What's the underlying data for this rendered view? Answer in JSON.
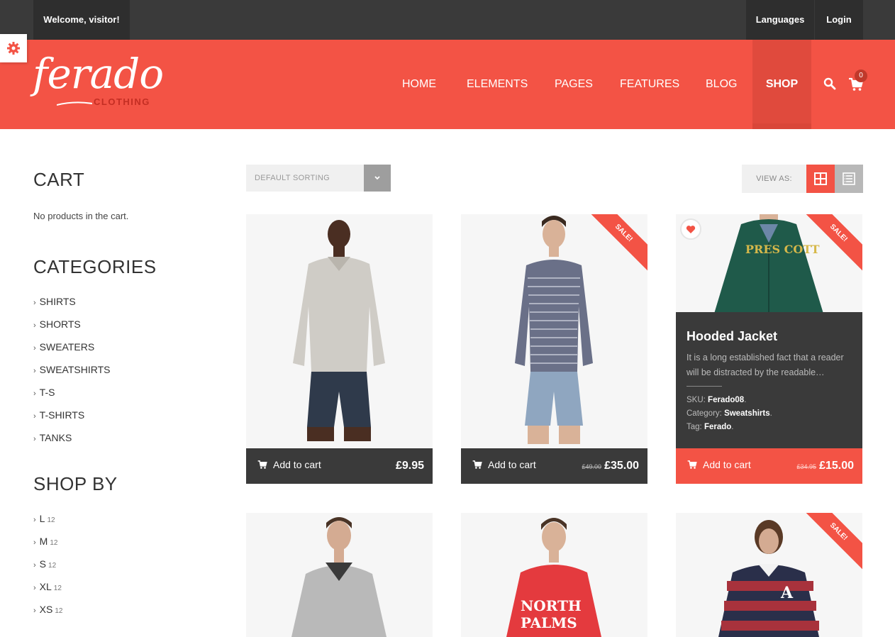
{
  "topbar": {
    "welcome": "Welcome, visitor!",
    "languages": "Languages",
    "login": "Login"
  },
  "header": {
    "logo_script": "ferado",
    "logo_sub": "CLOTHING",
    "nav": [
      "HOME",
      "ELEMENTS",
      "PAGES",
      "FEATURES",
      "BLOG",
      "SHOP"
    ],
    "active_nav": "SHOP",
    "cart_count": "0"
  },
  "sidebar": {
    "cart_title": "CART",
    "cart_empty": "No products in the cart.",
    "categories_title": "CATEGORIES",
    "categories": [
      "SHIRTS",
      "SHORTS",
      "SWEATERS",
      "SWEATSHIRTS",
      "T-S",
      "T-SHIRTS",
      "TANKS"
    ],
    "shopby_title": "SHOP BY",
    "sizes": [
      {
        "label": "L",
        "count": "12"
      },
      {
        "label": "M",
        "count": "12"
      },
      {
        "label": "S",
        "count": "12"
      },
      {
        "label": "XL",
        "count": "12"
      },
      {
        "label": "XS",
        "count": "12"
      }
    ]
  },
  "toolbar": {
    "sorting": "DEFAULT SORTING",
    "view_as": "VIEW AS:"
  },
  "products": [
    {
      "add_label": "Add to cart",
      "price": "£9.95",
      "old_price": "",
      "sale": false
    },
    {
      "add_label": "Add to cart",
      "price": "£35.00",
      "old_price": "£49.00",
      "sale": true,
      "sale_label": "SALE!"
    },
    {
      "add_label": "Add to cart",
      "price": "£15.00",
      "old_price": "£34.95",
      "sale": true,
      "sale_label": "SALE!",
      "title": "Hooded Jacket",
      "desc": "It is a long established fact that a reader will be distracted by the readable…",
      "sku_label": "SKU:",
      "sku": "Ferado08",
      "cat_label": "Category:",
      "category": "Sweatshirts",
      "tag_label": "Tag:",
      "tag": "Ferado",
      "jacket_print": "PRES COTT"
    },
    {
      "sale": false
    },
    {
      "sale": false,
      "hoodie_print_1": "NORTH",
      "hoodie_print_2": "PALMS"
    },
    {
      "sale": true,
      "sale_label": "SALE!"
    }
  ],
  "colors": {
    "accent": "#f35345",
    "dark": "#3a3a3a",
    "topbar": "#3a3a3a"
  },
  "icons": [
    "gear-icon",
    "search-icon",
    "cart-icon",
    "chevron-down-icon",
    "grid-view-icon",
    "list-view-icon",
    "heart-icon"
  ]
}
